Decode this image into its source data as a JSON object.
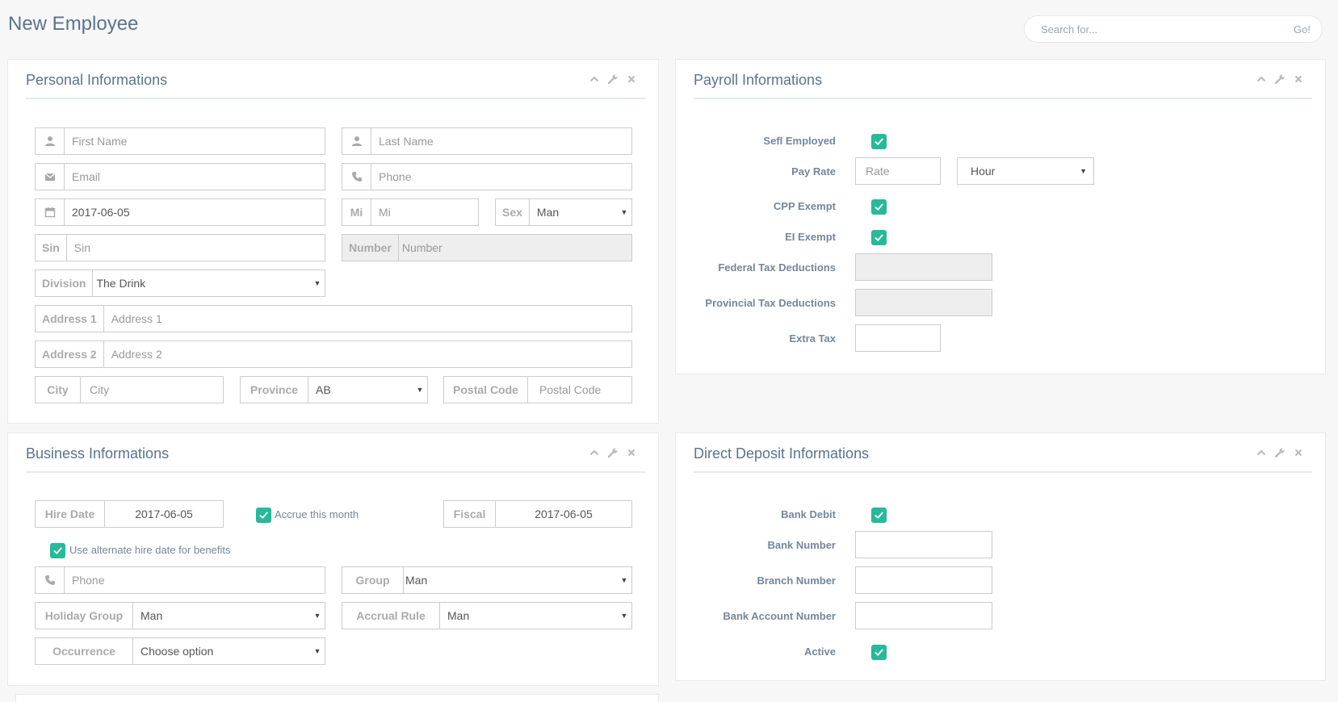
{
  "header": {
    "title": "New Employee",
    "search_placeholder": "Search for...",
    "search_button": "Go!"
  },
  "personal": {
    "title": "Personal Informations",
    "first_name_placeholder": "First Name",
    "last_name_placeholder": "Last Name",
    "email_placeholder": "Email",
    "phone_placeholder": "Phone",
    "date_value": "2017-06-05",
    "mi_addon": "Mi",
    "mi_placeholder": "Mi",
    "sex_addon": "Sex",
    "sex_value": "Man",
    "sin_addon": "Sin",
    "sin_placeholder": "Sin",
    "number_addon": "Number",
    "number_placeholder": "Number",
    "division_addon": "Division",
    "division_value": "The Drink",
    "address1_addon": "Address 1",
    "address1_placeholder": "Address 1",
    "address2_addon": "Address 2",
    "address2_placeholder": "Address 2",
    "city_addon": "City",
    "city_placeholder": "City",
    "province_addon": "Province",
    "province_value": "AB",
    "postal_addon": "Postal Code",
    "postal_placeholder": "Postal Cod⁠e"
  },
  "business": {
    "title": "Business Informations",
    "hire_date_addon": "Hire Date",
    "hire_date_value": "2017-06-05",
    "accrue_label": "Accrue this month",
    "fiscal_addon": "Fiscal",
    "fiscal_value": "2017-06-05",
    "alt_hire_label": "Use alternate hire date for benefits",
    "phone_placeholder": "Phone",
    "group_addon": "Group",
    "group_value": "Man",
    "holiday_addon": "Holiday Group",
    "holiday_value": "Man",
    "accrual_addon": "Accrual Rule",
    "accrual_value": "Man",
    "occurrence_addon": "Occurrence",
    "occurrence_value": "Choose option"
  },
  "payroll": {
    "title": "Payroll Informations",
    "self_employed_label": "Sefl Employed",
    "pay_rate_label": "Pay Rate",
    "rate_placeholder": "Rate",
    "rate_unit_value": "Hour",
    "cpp_label": "CPP Exempt",
    "ei_label": "EI Exempt",
    "federal_label": "Federal Tax Deductions",
    "provincial_label": "Provincial Tax Deductions",
    "extra_label": "Extra Tax"
  },
  "deposit": {
    "title": "Direct Deposit Informations",
    "bank_debit_label": "Bank Debit",
    "bank_number_label": "Bank Number",
    "branch_number_label": "Branch Number",
    "account_number_label": "Bank Account Number",
    "active_label": "Active"
  },
  "colors": {
    "accent": "#26B99A",
    "title": "#5A738E",
    "text": "#73879C",
    "background": "#f7f7f7"
  }
}
